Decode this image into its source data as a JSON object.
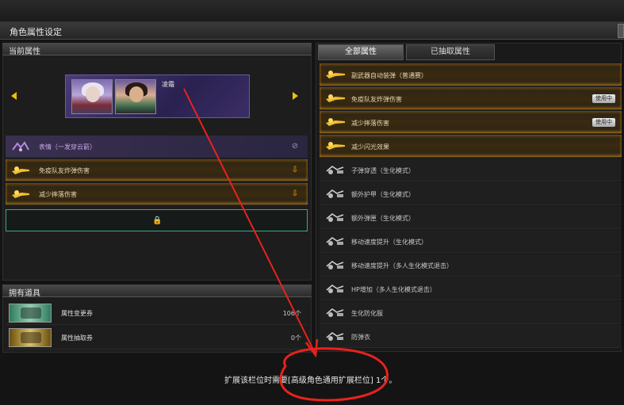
{
  "window": {
    "title": "角色属性设定"
  },
  "current_attributes": {
    "header": "当前属性",
    "character": {
      "name": "凌霜"
    },
    "rows": [
      {
        "label": "表情（一发穿云箭）",
        "icon": "emote-icon",
        "indicator": "disabled-icon"
      },
      {
        "label": "免疫队友炸弹伤害",
        "icon": "gold-weapon-icon",
        "indicator": "unlock-icon"
      },
      {
        "label": "减少摔落伤害",
        "icon": "gold-weapon-icon",
        "indicator": "unlock-icon"
      }
    ],
    "locked_slot_icon": "lock-icon"
  },
  "owned_items": {
    "header": "拥有道具",
    "items": [
      {
        "name": "属性变更券",
        "count": "106个",
        "icon": "ticket-green-icon"
      },
      {
        "name": "属性抽取券",
        "count": "0个",
        "icon": "ticket-gold-icon"
      }
    ]
  },
  "tabs": [
    {
      "label": "全部属性",
      "active": true
    },
    {
      "label": "已抽取属性",
      "active": false
    }
  ],
  "attribute_list": [
    {
      "label": "副武器自动装弹（普通赛）",
      "style": "gold",
      "badge": ""
    },
    {
      "label": "免疫队友炸弹伤害",
      "style": "gold",
      "badge": "使用中"
    },
    {
      "label": "减少摔落伤害",
      "style": "gold",
      "badge": "使用中"
    },
    {
      "label": "减少闪光效果",
      "style": "gold",
      "badge": ""
    },
    {
      "label": "子弹穿透（生化模式）",
      "style": "plain",
      "badge": ""
    },
    {
      "label": "额外护甲（生化模式）",
      "style": "plain",
      "badge": ""
    },
    {
      "label": "额外弹匣（生化模式）",
      "style": "plain",
      "badge": ""
    },
    {
      "label": "移动速度提升（生化模式）",
      "style": "plain",
      "badge": ""
    },
    {
      "label": "移动速度提升（多人生化模式退击）",
      "style": "plain",
      "badge": ""
    },
    {
      "label": "HP增加（多人生化模式退击）",
      "style": "plain",
      "badge": ""
    },
    {
      "label": "生化防化服",
      "style": "plain",
      "badge": ""
    },
    {
      "label": "防弹衣",
      "style": "plain",
      "badge": ""
    }
  ],
  "footer": {
    "message": "扩展该栏位时需要[高级角色通用扩展栏位] 1个。"
  },
  "colors": {
    "accent_gold": "#f0b000",
    "slot_border": "#3aa88a",
    "annotation_red": "#e8221c"
  }
}
